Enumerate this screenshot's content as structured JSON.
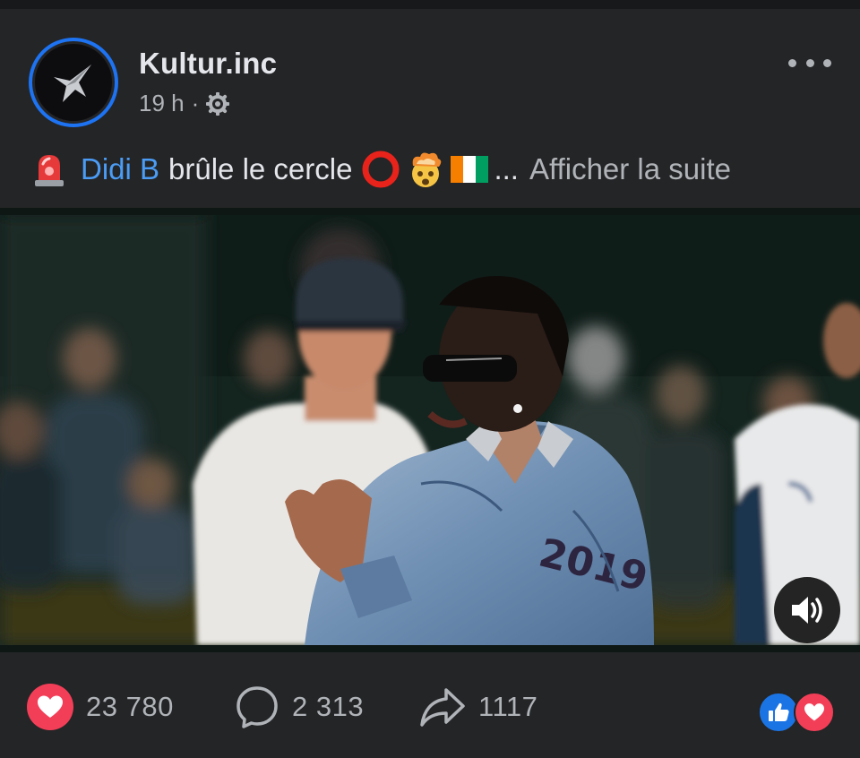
{
  "post": {
    "author": "Kultur.inc",
    "time": "19 h",
    "time_separator": "·",
    "caption": {
      "mention": "Didi B",
      "text": "brûle le cercle",
      "ellipsis": "...",
      "see_more": "Afficher la suite"
    }
  },
  "video": {
    "jersey_number": "2019",
    "sound": "on"
  },
  "actions": {
    "likes": "23 780",
    "comments": "2 313",
    "shares": "1117"
  },
  "colors": {
    "background": "#242526",
    "mention": "#4b9cf5",
    "love": "#f33e58",
    "like_blue": "#1b74e4",
    "avatar_ring": "#1d73f2"
  },
  "icons": [
    "avatar-star-logo",
    "siren-emoji",
    "red-circle-emoji",
    "exploding-head-emoji",
    "ivory-coast-flag-emoji",
    "globe-icon",
    "more-icon",
    "speaker-icon",
    "heart-icon",
    "comment-icon",
    "share-icon",
    "thumbs-up-icon"
  ]
}
